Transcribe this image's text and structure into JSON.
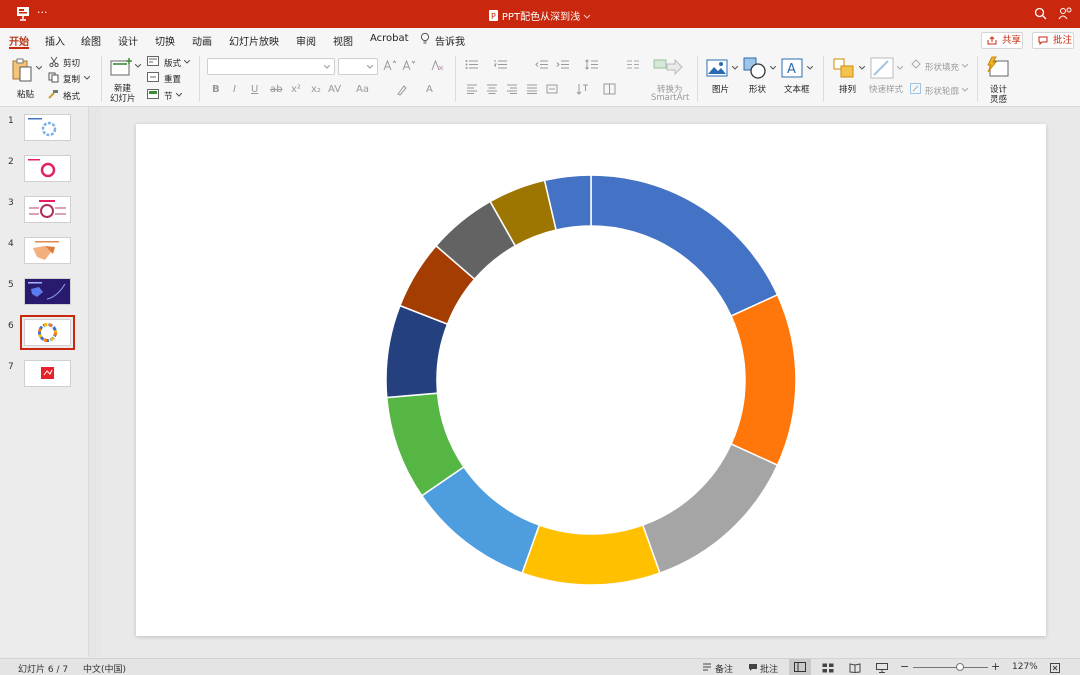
{
  "window": {
    "title": "PPT配色从深到浅",
    "more_label": "···"
  },
  "tabs": [
    "开始",
    "插入",
    "绘图",
    "设计",
    "切换",
    "动画",
    "幻灯片放映",
    "审阅",
    "视图",
    "Acrobat",
    "告诉我"
  ],
  "actions": {
    "share": "共享",
    "comment": "批注"
  },
  "ribbon": {
    "paste": "粘贴",
    "cut": "剪切",
    "copy": "复制",
    "format": "格式",
    "new_slide": "新建\n幻灯片",
    "new_slide_l1": "新建",
    "new_slide_l2": "幻灯片",
    "layout": "版式",
    "reset": "重置",
    "section": "节",
    "convert_smartart_l1": "转换为",
    "convert_smartart_l2": "SmartArt",
    "picture": "图片",
    "shape": "形状",
    "textbox": "文本框",
    "arrange": "排列",
    "quick_styles": "快速样式",
    "shape_fill": "形状填充",
    "shape_outline": "形状轮廓",
    "designer_l1": "设计",
    "designer_l2": "灵感"
  },
  "slides": [
    {
      "number": "1"
    },
    {
      "number": "2"
    },
    {
      "number": "3"
    },
    {
      "number": "4"
    },
    {
      "number": "5"
    },
    {
      "number": "6",
      "selected": true
    },
    {
      "number": "7"
    }
  ],
  "chart_data": {
    "type": "donut",
    "values": [
      20,
      15,
      14,
      12,
      11,
      9,
      8,
      6,
      6,
      5,
      4
    ],
    "colors": [
      "#4472c4",
      "#ff760b",
      "#a5a5a5",
      "#ffc000",
      "#4e9ddf",
      "#55b643",
      "#24407f",
      "#a33d02",
      "#636363",
      "#9c7600",
      "#4472c4"
    ]
  },
  "status": {
    "slide_indicator": "幻灯片 6 / 7",
    "language": "中文(中国)",
    "notes": "备注",
    "comments": "批注",
    "zoom": "127%",
    "zoom_fraction": 0.62
  }
}
